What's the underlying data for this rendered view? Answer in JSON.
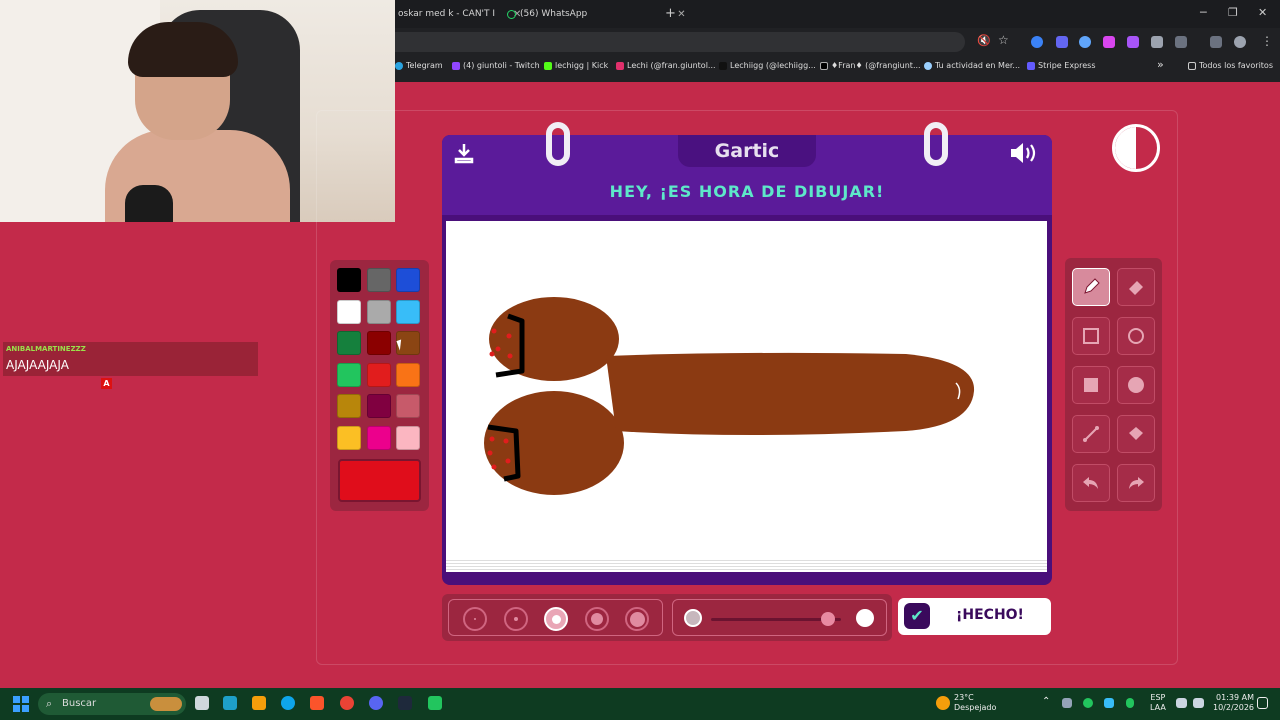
{
  "browser": {
    "tabs": [
      {
        "label": "oskar med k - CAN'T I",
        "close": "✕"
      },
      {
        "label": "(56) WhatsApp",
        "close": "✕"
      }
    ],
    "new_tab": "+",
    "window_controls": {
      "minimize": "─",
      "maximize": "❐",
      "close": "✕"
    },
    "bookmarks": [
      "Telegram",
      "(4) giuntoli - Twitch",
      "lechigg | Kick",
      "Lechi (@fran.giuntol...",
      "Lechiigg (@lechiigg...",
      "♦Fran♦ (@frangiunt...",
      "Tu actividad en Mer...",
      "Stripe Express"
    ],
    "bookmarks_more": "»",
    "all_bookmarks": "Todos los favoritos"
  },
  "chat": {
    "username": "ANIBALMARTINEZZZ",
    "message": "AJAJAAJAJA",
    "badge": "A"
  },
  "game": {
    "logo": "Gartic",
    "heading": "HEY, ¡ES HORA DE DIBUJAR!",
    "done_label": "¡HECHO!",
    "palette": [
      "#000000",
      "#666666",
      "#1d4ed8",
      "#ffffff",
      "#aaaaaa",
      "#38bdf8",
      "#15803d",
      "#8b0000",
      "#8b4513",
      "#22c55e",
      "#e11d1d",
      "#f97316",
      "#b8860b",
      "#800040",
      "#c75a6a",
      "#fbbf24",
      "#ec008c",
      "#fbb6c1"
    ],
    "selected_color": "#e00d1b",
    "brush_sizes_selected_index": 2,
    "opacity_level": 0.9,
    "tools": [
      "pencil",
      "eraser",
      "rectangle-outline",
      "circle-outline",
      "rectangle-filled",
      "circle-filled",
      "line",
      "fill-bucket",
      "undo",
      "redo"
    ],
    "active_tool": "pencil"
  },
  "taskbar": {
    "search": "Buscar",
    "weather_temp": "23°C",
    "weather_desc": "Despejado",
    "lang": "ESP",
    "lang_sub": "LAA",
    "time": "01:39 AM",
    "date": "10/2/2026"
  }
}
